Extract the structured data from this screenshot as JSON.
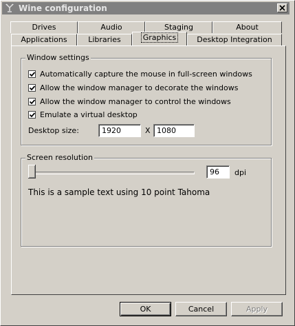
{
  "window": {
    "title": "Wine configuration"
  },
  "tabs": {
    "row_back": [
      "Drives",
      "Audio",
      "Staging",
      "About"
    ],
    "row_front": [
      "Applications",
      "Libraries",
      "Graphics",
      "Desktop Integration"
    ],
    "active": "Graphics"
  },
  "window_settings": {
    "label": "Window settings",
    "options": [
      {
        "label": "Automatically capture the mouse in full-screen windows",
        "checked": true
      },
      {
        "label": "Allow the window manager to decorate the windows",
        "checked": true
      },
      {
        "label": "Allow the window manager to control the windows",
        "checked": true
      },
      {
        "label": "Emulate a virtual desktop",
        "checked": true
      }
    ],
    "desktop_size_label": "Desktop size:",
    "width": "1920",
    "separator": "X",
    "height": "1080"
  },
  "screen_resolution": {
    "label": "Screen resolution",
    "dpi_value": "96",
    "dpi_unit": "dpi",
    "sample_text": "This is a sample text using 10 point Tahoma"
  },
  "buttons": {
    "ok": "OK",
    "cancel": "Cancel",
    "apply": "Apply"
  }
}
